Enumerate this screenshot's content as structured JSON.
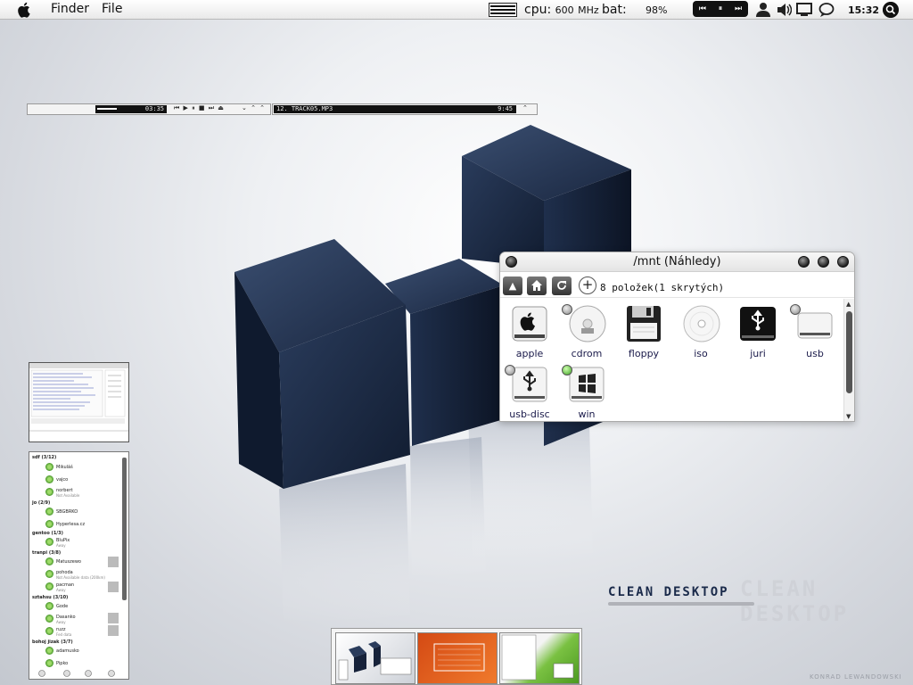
{
  "menubar": {
    "apple_icon": "apple-logo-icon",
    "items": [
      "Finder",
      "File"
    ],
    "cpu_label": "cpu:",
    "cpu_value": "600",
    "cpu_unit": "MHz",
    "bat_label": "bat:",
    "bat_value": "98%",
    "media_buttons": [
      "⏮",
      "⏸",
      "⏭"
    ],
    "tray_icons": [
      "user-icon",
      "volume-icon",
      "display-icon",
      "chat-icon"
    ],
    "clock": "15:32",
    "search_icon": "search-icon"
  },
  "player": {
    "time": "03:35",
    "controls": "⏮ ▶ ⏸ ■ ⏭ ⏏",
    "arrows": "⌄ ⌃ ⌃",
    "track": "12. TRACK05.MP3",
    "track_length": "9:45"
  },
  "file_manager": {
    "title": "/mnt (Náhledy)",
    "toolbar": {
      "up_label": "▲",
      "home_icon": "home-icon",
      "reload_icon": "reload-icon",
      "add_label": "+"
    },
    "item_count": "8 položek(1 skrytých)",
    "items": [
      {
        "label": "apple",
        "icon": "apple-drive-icon",
        "led": "none"
      },
      {
        "label": "cdrom",
        "icon": "cdrom-icon",
        "led": "off"
      },
      {
        "label": "floppy",
        "icon": "floppy-icon",
        "led": "none"
      },
      {
        "label": "iso",
        "icon": "disc-icon",
        "led": "none"
      },
      {
        "label": "juri",
        "icon": "usb-drive-black-icon",
        "led": "none"
      },
      {
        "label": "usb",
        "icon": "drive-icon",
        "led": "off"
      },
      {
        "label": "usb-disc",
        "icon": "usb-drive-icon",
        "led": "off"
      },
      {
        "label": "win",
        "icon": "windows-drive-icon",
        "led": "on"
      }
    ]
  },
  "contacts": {
    "groups": [
      {
        "name": "sdf",
        "count": "(3/12)",
        "contacts": [
          {
            "name": "Mikuláš",
            "sub": ""
          },
          {
            "name": "vajco",
            "sub": ""
          },
          {
            "name": "norbert",
            "sub": "Not Available"
          }
        ]
      },
      {
        "name": "jo",
        "count": "(2/9)",
        "contacts": [
          {
            "name": "SBGBRKO",
            "sub": ""
          },
          {
            "name": "Hyperlesa.cz",
            "sub": ""
          }
        ]
      },
      {
        "name": "gentoo",
        "count": "(1/3)",
        "contacts": [
          {
            "name": "BluPix",
            "sub": "Away"
          }
        ]
      },
      {
        "name": "tranpi",
        "count": "(3/8)",
        "contacts": [
          {
            "name": "Matuszewo",
            "sub": ""
          },
          {
            "name": "pohoda",
            "sub": "Not Available data (200km)"
          },
          {
            "name": "pacman",
            "sub": "Away"
          }
        ]
      },
      {
        "name": "sztahsu",
        "count": "(3/10)",
        "contacts": [
          {
            "name": "Gode",
            "sub": ""
          },
          {
            "name": "Dasanko",
            "sub": "Away"
          },
          {
            "name": "ruzz",
            "sub": "Fed data"
          }
        ]
      },
      {
        "name": "bohoj jizak",
        "count": "(3/7)",
        "contacts": [
          {
            "name": "adamusko",
            "sub": ""
          },
          {
            "name": "Pipko",
            "sub": ""
          }
        ]
      }
    ]
  },
  "branding": {
    "title": "CLEAN DESKTOP",
    "credit": "KONRAD LEWANDOWSKI"
  },
  "colors": {
    "accent_dark": "#1a2a4a",
    "cube_navy": "#1b2a45",
    "led_green": "#3aa020"
  }
}
